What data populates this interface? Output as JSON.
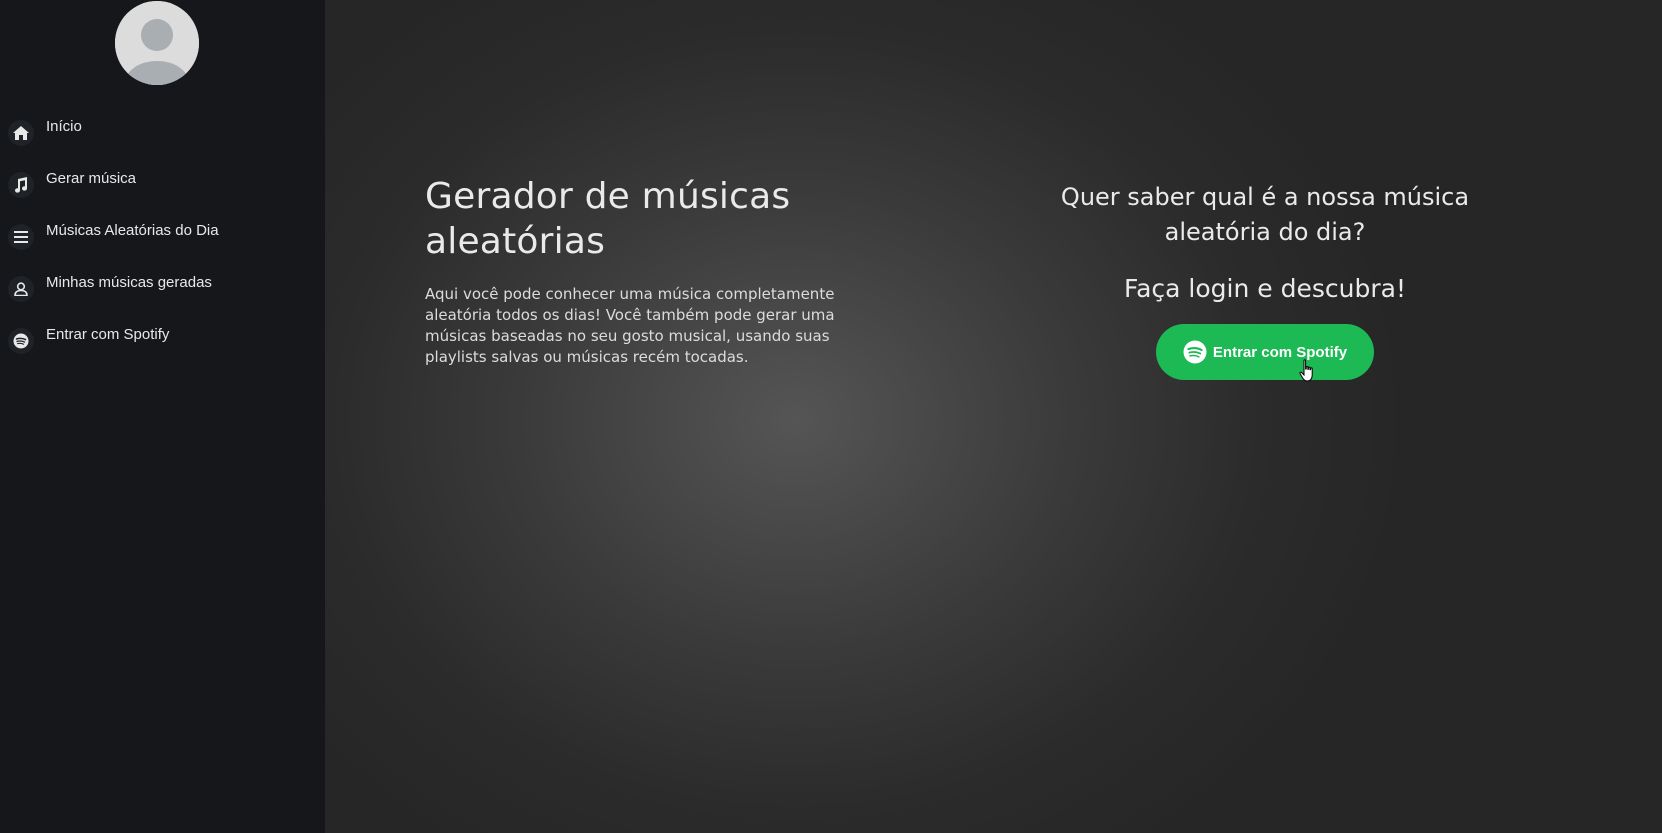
{
  "sidebar": {
    "avatar": "user-avatar-placeholder",
    "items": [
      {
        "label": "Início",
        "icon": "home-icon"
      },
      {
        "label": "Gerar música",
        "icon": "music-note-icon"
      },
      {
        "label": "Músicas Aleatórias do Dia",
        "icon": "list-icon"
      },
      {
        "label": "Minhas músicas geradas",
        "icon": "user-icon"
      },
      {
        "label": "Entrar com Spotify",
        "icon": "spotify-icon"
      }
    ]
  },
  "main": {
    "title": "Gerador de músicas aleatórias",
    "description": "Aqui você pode conhecer uma música completamente aleatória todos os dias! Você também pode gerar uma músicas baseadas no seu gosto musical, usando suas playlists salvas ou músicas recém tocadas.",
    "question": "Quer saber qual é a nossa música aleatória do dia?",
    "cta": "Faça login e descubra!",
    "login_button": {
      "label": "Entrar com Spotify",
      "icon": "spotify-icon"
    }
  },
  "colors": {
    "sidebar_bg": "#15171b",
    "spotify_green": "#1db954",
    "text": "#eaeaea"
  }
}
